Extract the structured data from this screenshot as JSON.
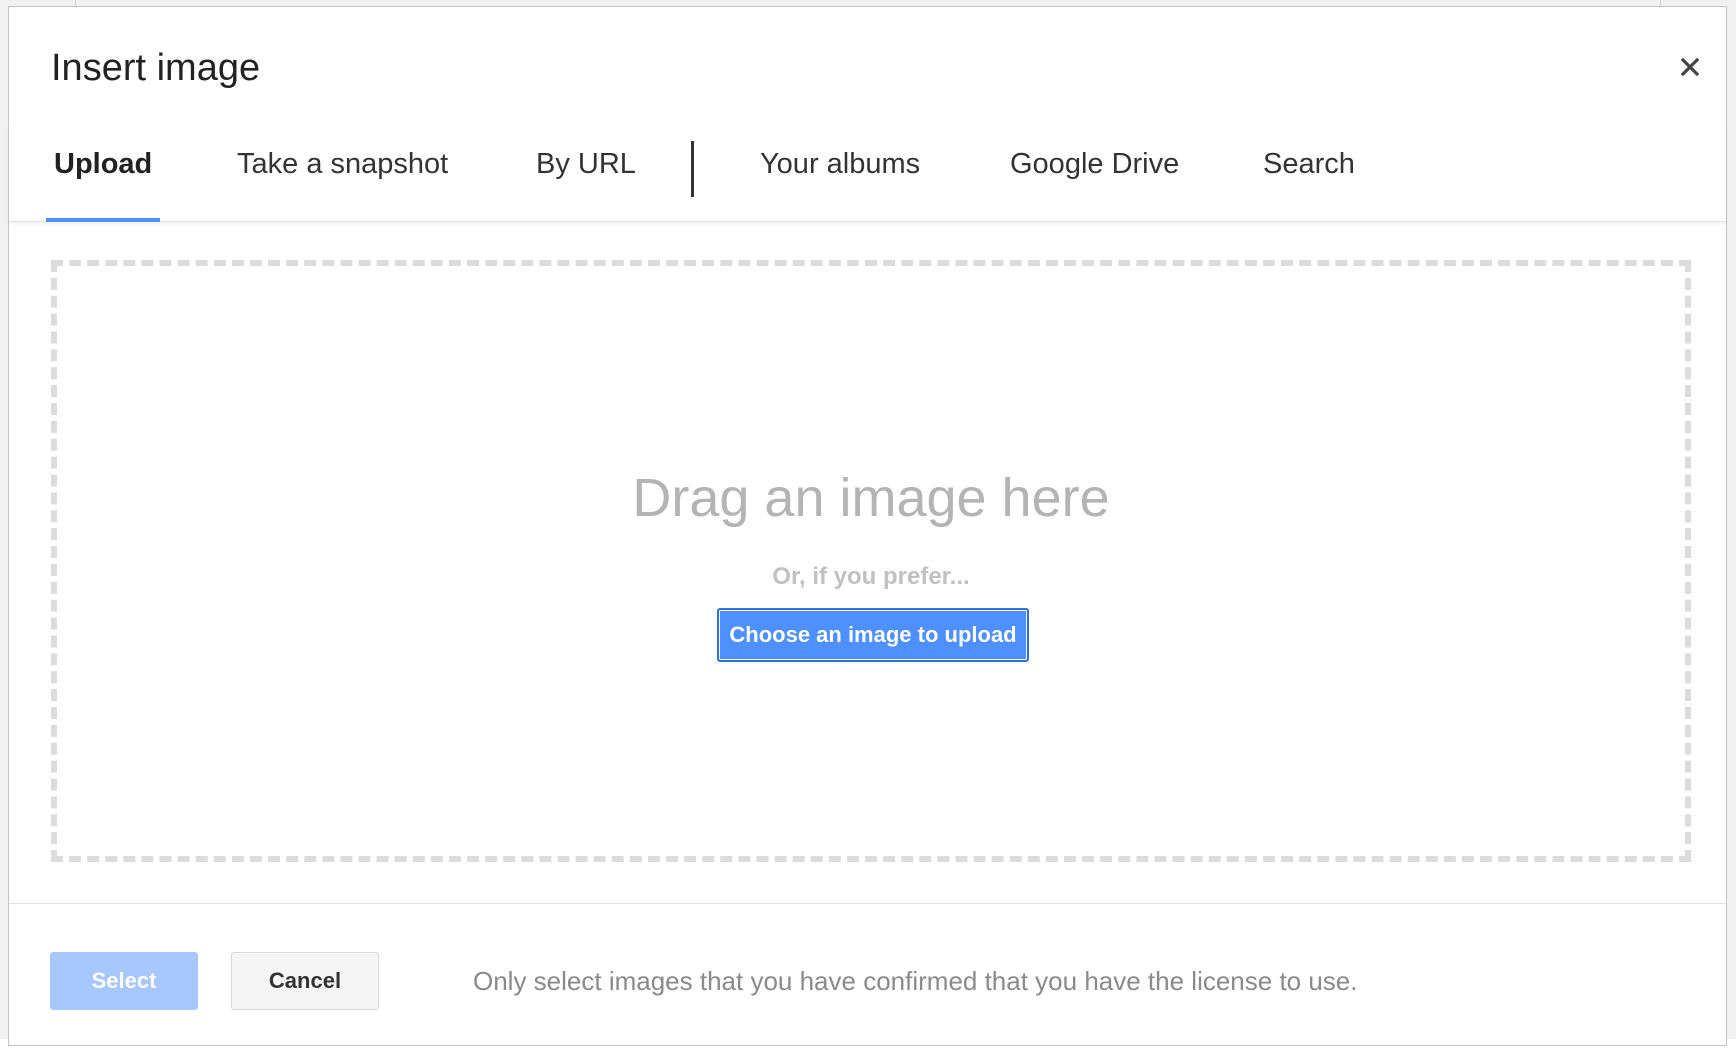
{
  "dialog": {
    "title": "Insert image",
    "close_icon": "close-icon"
  },
  "tabs": [
    {
      "label": "Upload",
      "active": true
    },
    {
      "label": "Take a snapshot",
      "active": false
    },
    {
      "label": "By URL",
      "active": false
    },
    {
      "label": "Your albums",
      "active": false
    },
    {
      "label": "Google Drive",
      "active": false
    },
    {
      "label": "Search",
      "active": false
    }
  ],
  "upload": {
    "drag_text": "Drag an image here",
    "prefer_text": "Or, if you prefer...",
    "choose_button": "Choose an image to upload"
  },
  "footer": {
    "select_label": "Select",
    "cancel_label": "Cancel",
    "license_text": "Only select images that you have confirmed that you have the license to use."
  },
  "colors": {
    "accent": "#4d90fe",
    "select_disabled": "#a6c8ff",
    "dropzone_border": "#dcdcdc"
  }
}
